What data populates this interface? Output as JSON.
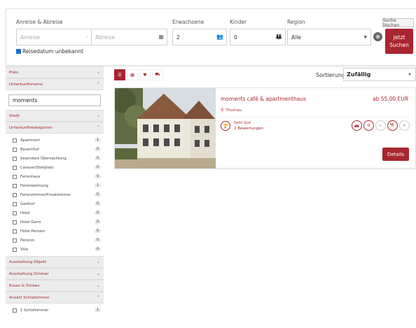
{
  "search": {
    "label_dates": "Anreise & Abreise",
    "arrival_placeholder": "Anreise",
    "date_separator": "-",
    "departure_placeholder": "Abreise",
    "label_adults": "Erwachsene",
    "adults_value": "2",
    "label_children": "Kinder",
    "children_value": "0",
    "label_region": "Region",
    "region_value": "Alle",
    "clear_label": "Suche löschen",
    "submit_line1": "Jetzt",
    "submit_line2": "Suchen",
    "unknown_date_label": "Reisedatum unbekannt",
    "unknown_date_checked": true
  },
  "sidebar": {
    "sections_top": [
      {
        "label": "Preis",
        "open": false
      },
      {
        "label": "Unterkunftsname",
        "open": true
      }
    ],
    "name_filter_value": "moments",
    "city_label": "Stadt",
    "categories_label": "Unterkunftskategorien",
    "categories": [
      {
        "name": "Apartment",
        "count": "1"
      },
      {
        "name": "Bauernhof",
        "count": "0"
      },
      {
        "name": "besondere Übernachtung",
        "count": "0"
      },
      {
        "name": "Caravan/Stellplatz",
        "count": "0"
      },
      {
        "name": "Ferienhaus",
        "count": "0"
      },
      {
        "name": "Ferienwohnung",
        "count": "1"
      },
      {
        "name": "Ferienzimmer/Privatzimmer",
        "count": "0"
      },
      {
        "name": "Gasthof",
        "count": "0"
      },
      {
        "name": "Hotel",
        "count": "0"
      },
      {
        "name": "Hotel Garni",
        "count": "0"
      },
      {
        "name": "Hotel-Pension",
        "count": "0"
      },
      {
        "name": "Pension",
        "count": "0"
      },
      {
        "name": "Villa",
        "count": "0"
      }
    ],
    "sections_bottom": [
      {
        "label": "Ausstattung Objekt",
        "open": false
      },
      {
        "label": "Ausstattung Zimmer",
        "open": false
      },
      {
        "label": "Essen & Trinken",
        "open": false
      },
      {
        "label": "Anzahl Schlafzimmer",
        "open": true
      }
    ],
    "bedrooms": [
      {
        "name": "1 Schlafzimmer",
        "count": "1"
      }
    ]
  },
  "toolbar": {
    "sort_label": "Sortierung",
    "sort_value": "Zufällig",
    "view_icons": [
      "list-icon",
      "grid-icon",
      "heart-icon",
      "cart-icon"
    ]
  },
  "result": {
    "title": "moments café & apartmenthaus",
    "price": "ab 55,00 EUR",
    "location": "Thurnau",
    "rating_text": "Sehr Gut",
    "reviews_text": "2 Bewertungen",
    "details_label": "Details",
    "features": [
      {
        "icon": "car-icon",
        "active": true
      },
      {
        "icon": "no-smoking-icon",
        "active": true
      },
      {
        "icon": "wheelchair-icon",
        "active": false
      },
      {
        "icon": "pet-icon",
        "active": true
      },
      {
        "icon": "spa-icon",
        "active": false
      }
    ]
  },
  "colors": {
    "accent": "#a8262f",
    "checkbox": "#1a73c9",
    "sidebar_header": "#ececec"
  }
}
